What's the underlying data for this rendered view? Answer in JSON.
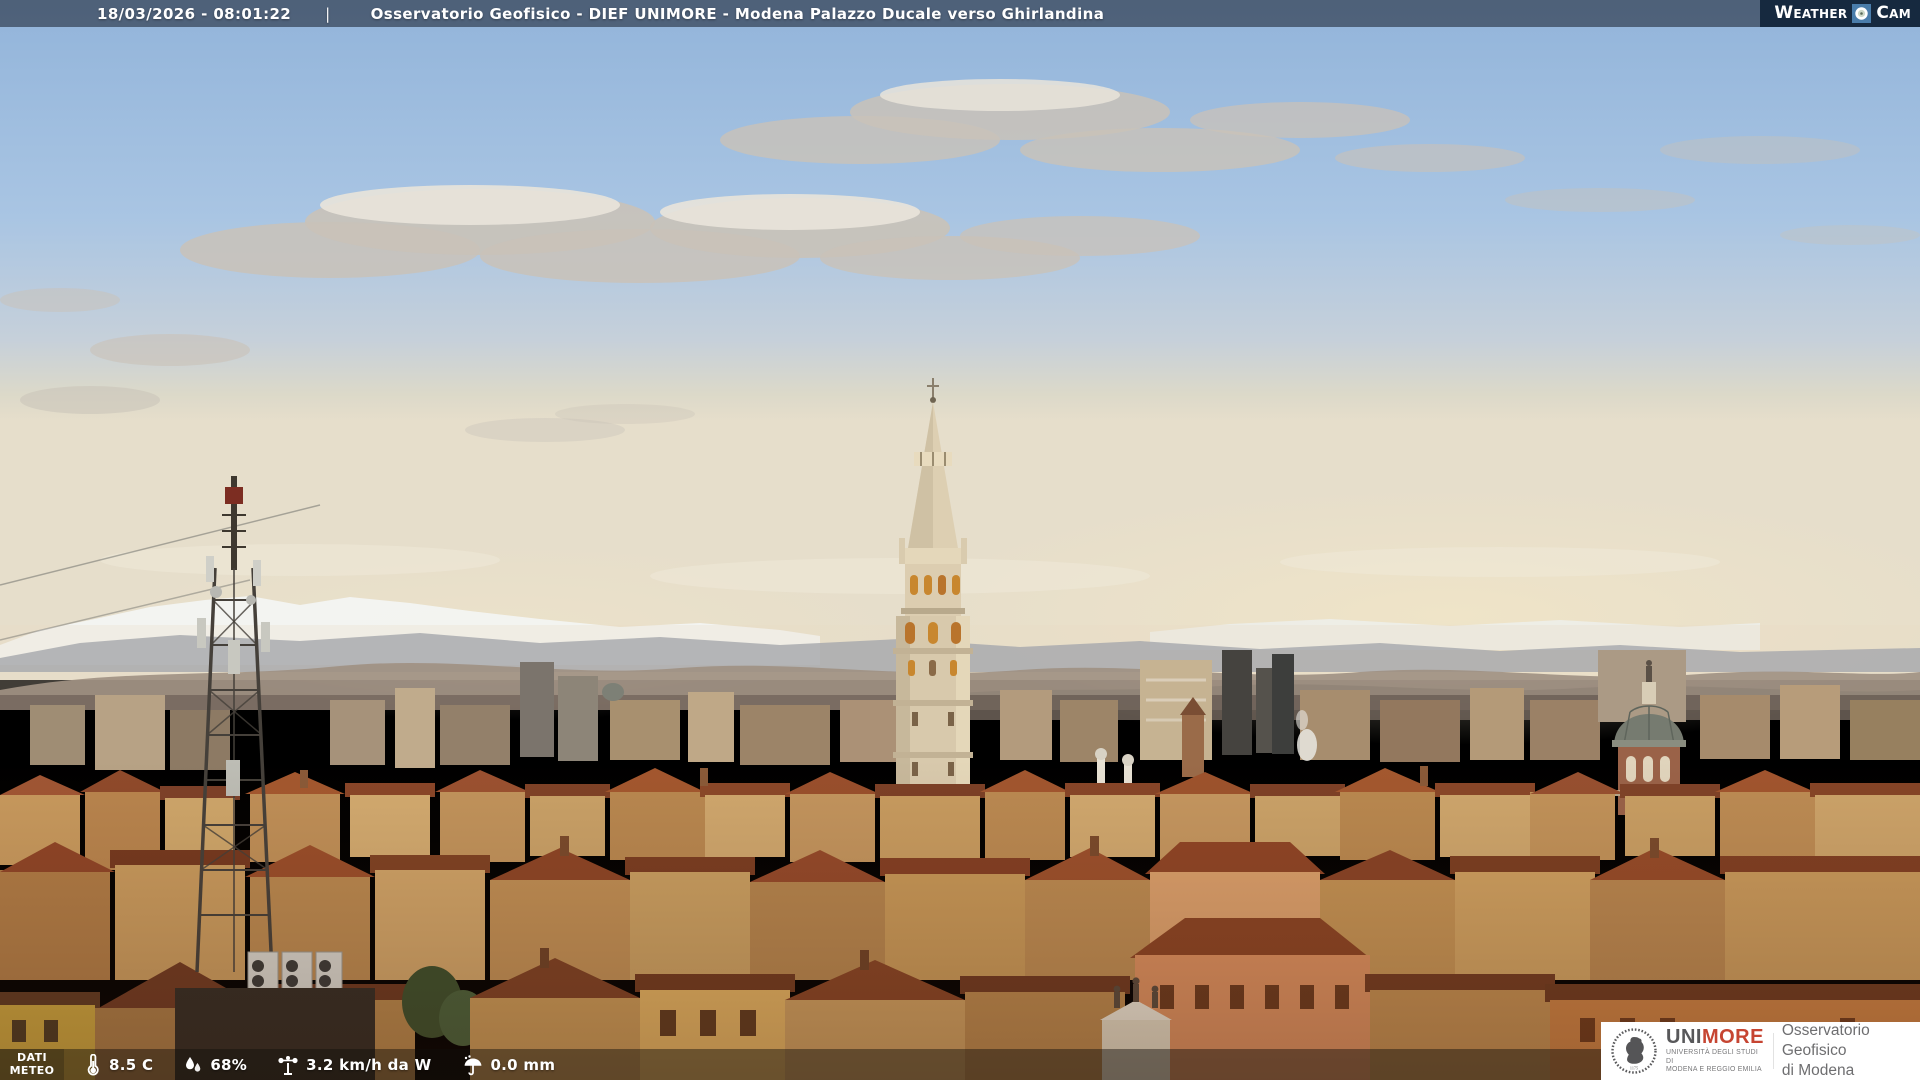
{
  "header": {
    "datetime": "18/03/2026 - 08:01:22",
    "separator": "|",
    "title": "Osservatorio Geofisico - DIEF UNIMORE - Modena Palazzo Ducale verso Ghirlandina"
  },
  "weathercam": {
    "weather": "Weather",
    "cam": "Cam",
    "lens_icon": "camera-lens-icon"
  },
  "meteo": {
    "label_line1": "DATI",
    "label_line2": "METEO",
    "readings": [
      {
        "icon": "thermometer-icon",
        "value": "8.5 C"
      },
      {
        "icon": "humidity-drops-icon",
        "value": "68%"
      },
      {
        "icon": "anemometer-icon",
        "value": "3.2 km/h da W"
      },
      {
        "icon": "umbrella-rain-icon",
        "value": "0.0 mm"
      }
    ]
  },
  "logo_panel": {
    "unimore_uni": "UNI",
    "unimore_more": "MORE",
    "university_line1": "UNIVERSITÀ DEGLI STUDI DI",
    "university_line2": "MODENA E REGGIO EMILIA",
    "org_line1": "Osservatorio Geofisico",
    "org_line2": "di Modena"
  },
  "colors": {
    "unimore_red": "#c64532",
    "weathercam_navy": "#16293f",
    "weathercam_blue": "#4a7dab",
    "overlay_bar": "rgba(16,22,32,0.5)",
    "panel_bg": "#ffffff"
  }
}
